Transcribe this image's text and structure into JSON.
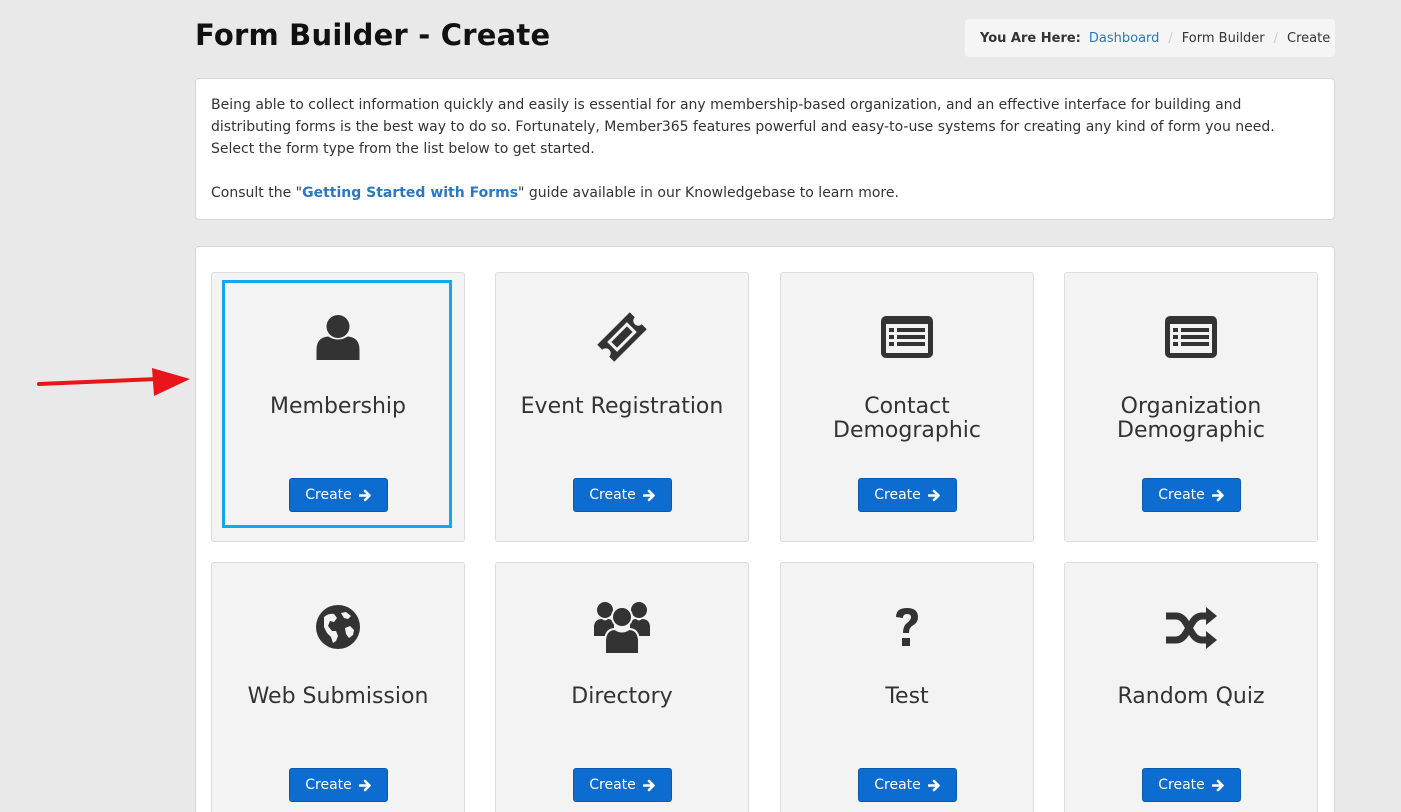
{
  "header": {
    "title": "Form Builder - Create"
  },
  "breadcrumb": {
    "lead": "You Are Here:",
    "items": [
      "Dashboard",
      "Form Builder",
      "Create"
    ],
    "separator": "/"
  },
  "intro": {
    "paragraph": "Being able to collect information quickly and easily is essential for any membership-based organization, and an effective interface for building and distributing forms is the best way to do so. Fortunately, Member365 features powerful and easy-to-use systems for creating any kind of form you need. Select the form type from the list below to get started.",
    "consult_prefix": "Consult the \"",
    "consult_link": "Getting Started with Forms",
    "consult_suffix": "\" guide available in our Knowledgebase to learn more."
  },
  "tiles": [
    {
      "title": "Membership",
      "icon": "user-icon",
      "button": "Create"
    },
    {
      "title": "Event Registration",
      "icon": "ticket-icon",
      "button": "Create"
    },
    {
      "title": "Contact\nDemographic",
      "icon": "list-alt-icon",
      "button": "Create"
    },
    {
      "title": "Organization\nDemographic",
      "icon": "list-alt-icon",
      "button": "Create"
    },
    {
      "title": "Web Submission",
      "icon": "globe-icon",
      "button": "Create"
    },
    {
      "title": "Directory",
      "icon": "group-icon",
      "button": "Create"
    },
    {
      "title": "Test",
      "icon": "question-icon",
      "button": "Create"
    },
    {
      "title": "Random Quiz",
      "icon": "random-icon",
      "button": "Create"
    }
  ],
  "colors": {
    "accent": "#0c6ccf",
    "selection_border": "#10a8ee",
    "annotation_arrow": "#e8161b",
    "link": "#2a78c2"
  }
}
